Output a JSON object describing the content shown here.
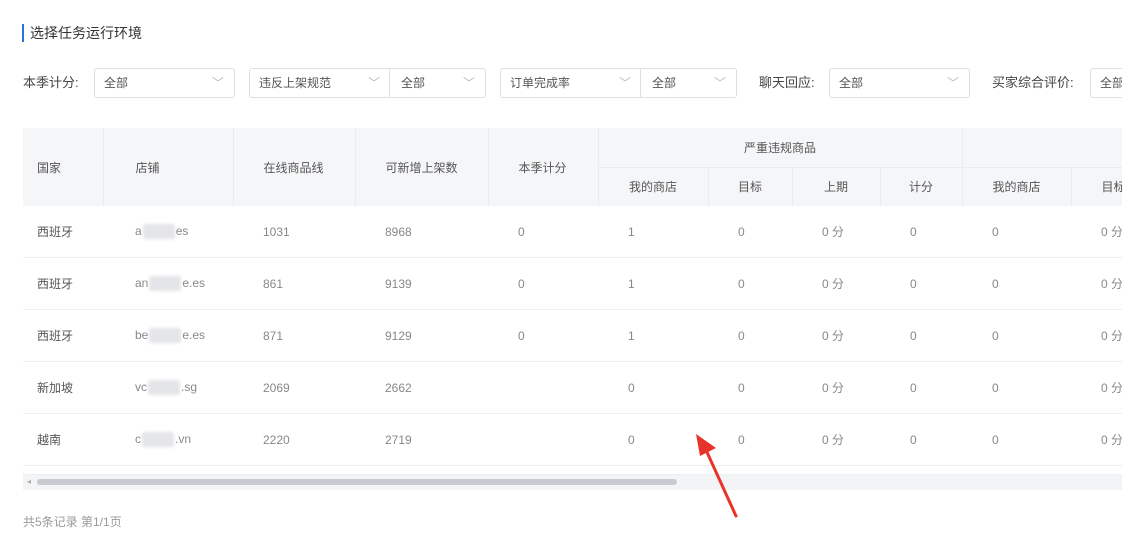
{
  "section": {
    "title": "选择任务运行环境"
  },
  "filters": {
    "season_score": {
      "label": "本季计分:",
      "value": "全部"
    },
    "violation": {
      "left_value": "违反上架规范",
      "right_value": "全部"
    },
    "order_rate": {
      "left_value": "订单完成率",
      "right_value": "全部"
    },
    "chat": {
      "label": "聊天回应:",
      "value": "全部"
    },
    "buyer_rating": {
      "label": "买家综合评价:",
      "value": "全部"
    }
  },
  "table": {
    "headers": {
      "country": "国家",
      "shop": "店铺",
      "online_lines": "在线商品线",
      "new_listings": "可新增上架数",
      "season_score": "本季计分",
      "group_serious": "严重违规商品",
      "my_shop": "我的商店",
      "target": "目标",
      "previous": "上期",
      "score": "计分",
      "my_shop2": "我的商店",
      "target2": "目标"
    },
    "rows": [
      {
        "country": "西班牙",
        "shop_prefix": "a",
        "shop_suffix": "es",
        "online": "1031",
        "new": "8968",
        "season": "0",
        "my": "1",
        "target": "0",
        "prev": "0 分",
        "score": "0",
        "my2": "0",
        "target2": "0 分"
      },
      {
        "country": "西班牙",
        "shop_prefix": "an",
        "shop_suffix": "e.es",
        "online": "861",
        "new": "9139",
        "season": "0",
        "my": "1",
        "target": "0",
        "prev": "0 分",
        "score": "0",
        "my2": "0",
        "target2": "0 分"
      },
      {
        "country": "西班牙",
        "shop_prefix": "be",
        "shop_suffix": "e.es",
        "online": "871",
        "new": "9129",
        "season": "0",
        "my": "1",
        "target": "0",
        "prev": "0 分",
        "score": "0",
        "my2": "0",
        "target2": "0 分"
      },
      {
        "country": "新加坡",
        "shop_prefix": "vc",
        "shop_suffix": ".sg",
        "online": "2069",
        "new": "2662",
        "season": "",
        "my": "0",
        "target": "0",
        "prev": "0 分",
        "score": "0",
        "my2": "0",
        "target2": "0 分"
      },
      {
        "country": "越南",
        "shop_prefix": "c",
        "shop_suffix": ".vn",
        "online": "2220",
        "new": "2719",
        "season": "",
        "my": "0",
        "target": "0",
        "prev": "0 分",
        "score": "0",
        "my2": "0",
        "target2": "0 分"
      }
    ]
  },
  "footer": {
    "summary": "共5条记录 第1/1页"
  },
  "annotation": {
    "arrow_color": "#e8332a"
  }
}
